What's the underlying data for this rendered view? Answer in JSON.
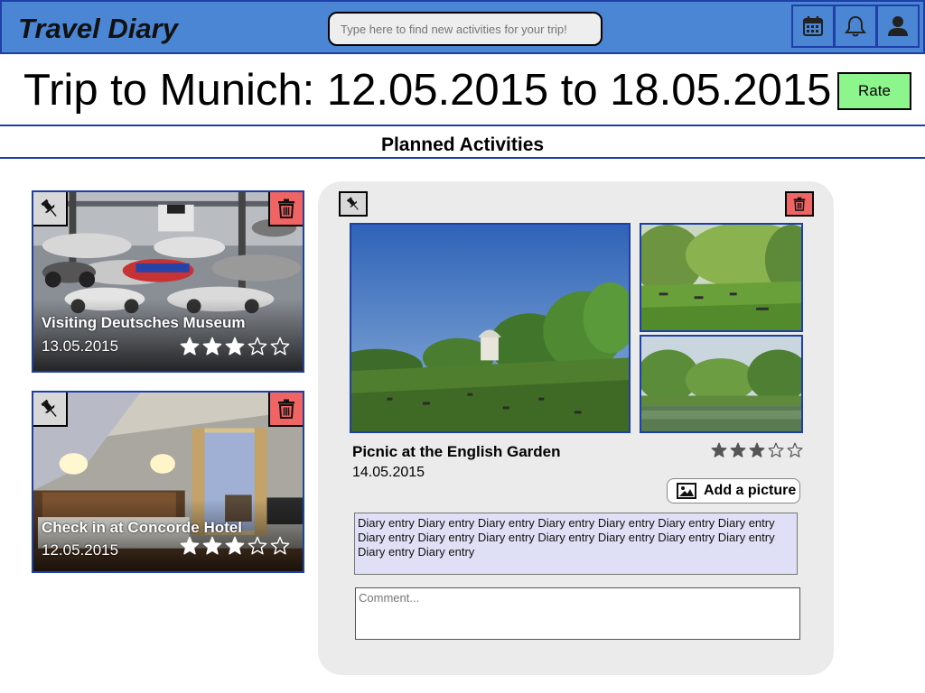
{
  "app": {
    "title": "Travel Diary"
  },
  "search": {
    "placeholder": "Type here to find new activities for your trip!"
  },
  "header_icons": [
    "calendar-icon",
    "bell-icon",
    "user-icon"
  ],
  "trip": {
    "title": "Trip to Munich: 12.05.2015 to 18.05.2015",
    "rate_label": "Rate"
  },
  "section": {
    "title": "Planned Activities"
  },
  "activities": [
    {
      "title": "Visiting Deutsches Museum",
      "date": "13.05.2015",
      "rating": 3,
      "max_rating": 5
    },
    {
      "title": "Check in at Concorde Hotel",
      "date": "12.05.2015",
      "rating": 3,
      "max_rating": 5
    }
  ],
  "detail": {
    "title": "Picnic at the English Garden",
    "date": "14.05.2015",
    "rating": 3,
    "max_rating": 5,
    "add_picture_label": "Add a picture",
    "diary_text": "Diary entry Diary entry Diary entry Diary entry Diary entry Diary entry Diary entry Diary entry Diary entry Diary entry Diary entry Diary entry Diary entry Diary entry Diary entry Diary entry",
    "comment_placeholder": "Comment..."
  },
  "colors": {
    "topbar": "#4a86d4",
    "border_blue": "#1f3fa8",
    "rate_button": "#8cf58c",
    "delete_button": "#f06464",
    "panel_bg": "#ebebeb",
    "diary_bg": "#dfe0f5"
  }
}
